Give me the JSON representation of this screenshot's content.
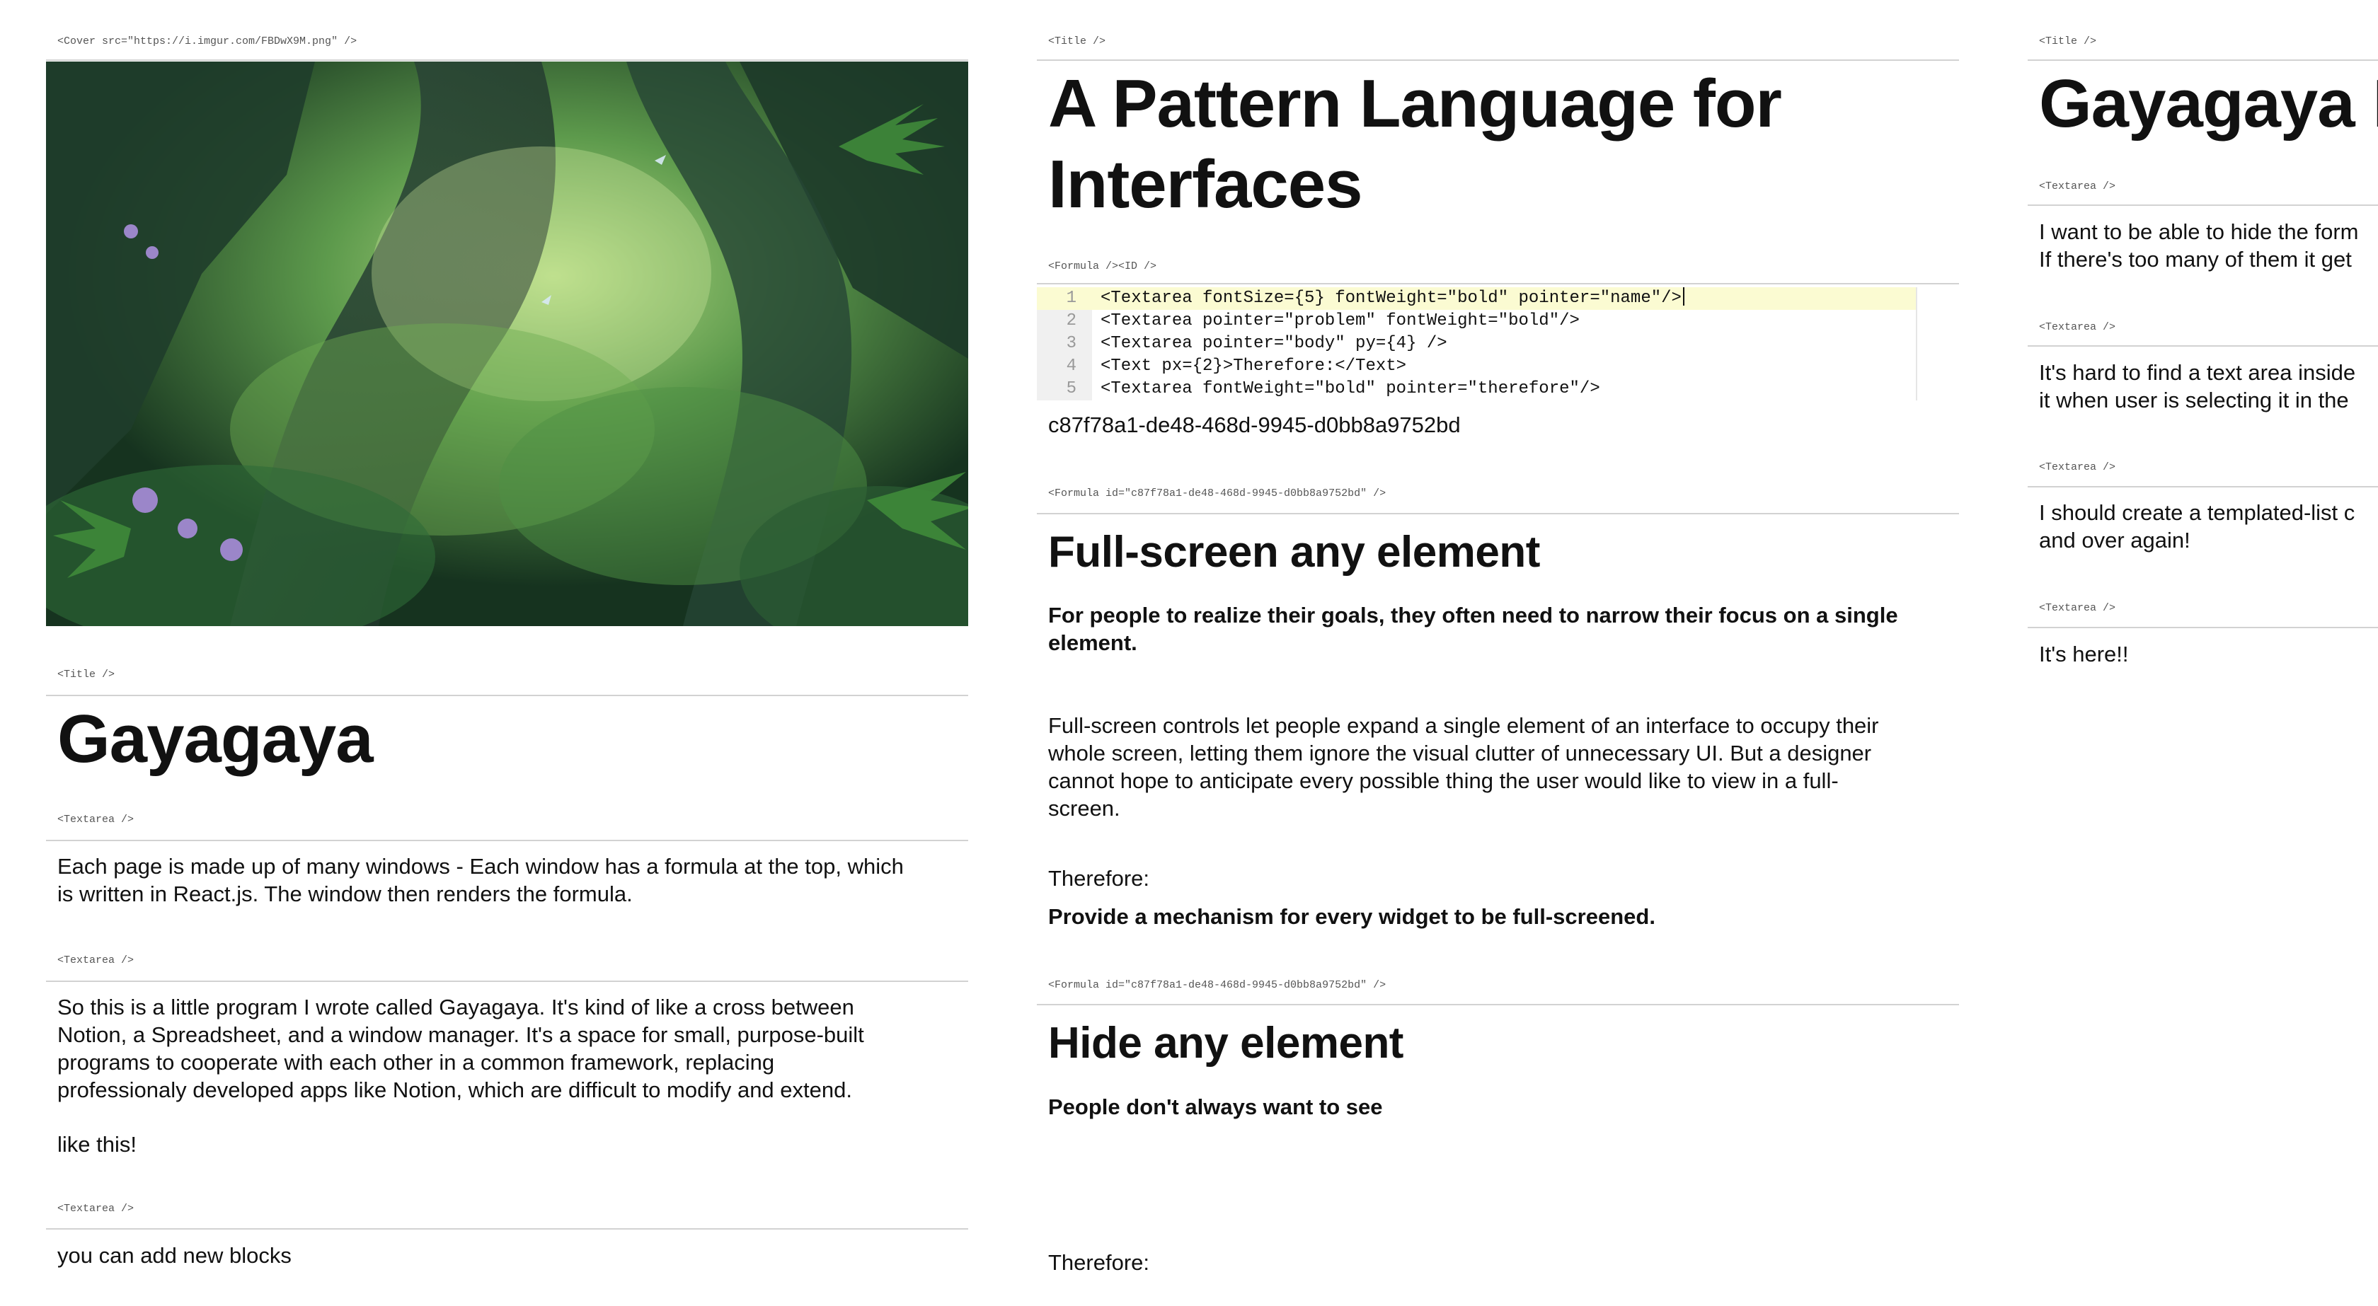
{
  "column1": {
    "cover": {
      "formula_label": "<Cover src=\"https://i.imgur.com/FBDwX9M.png\" />",
      "image_alt": "forest-illustration"
    },
    "title_block": {
      "formula_label": "<Title />",
      "title": "Gayagaya"
    },
    "textarea1": {
      "formula_label": "<Textarea />",
      "lines": [
        "Each page is made up of many windows - Each window has a formula at the top, which",
        "is written in React.js. The window then renders the formula."
      ]
    },
    "textarea2": {
      "formula_label": "<Textarea />",
      "lines": [
        "So this is a little program I wrote called Gayagaya. It's kind of like a cross between",
        "Notion, a Spreadsheet, and a window manager. It's a space for small, purpose-built",
        "programs to cooperate with each other in a common framework, replacing",
        "professionaly developed apps like Notion, which are difficult to modify and extend."
      ],
      "extra": "like this!"
    },
    "textarea3": {
      "formula_label": "<Textarea />",
      "text": "you can add new blocks"
    }
  },
  "column2": {
    "title_block": {
      "formula_label": "<Title />",
      "title_lines": [
        "A Pattern Language for",
        "Interfaces"
      ]
    },
    "formula_editor": {
      "formula_label": "<Formula /><ID />",
      "lines": [
        {
          "num": "1",
          "code": "<Textarea fontSize={5} fontWeight=\"bold\" pointer=\"name\"/>"
        },
        {
          "num": "2",
          "code": "<Textarea pointer=\"problem\" fontWeight=\"bold\"/>"
        },
        {
          "num": "3",
          "code": "<Textarea pointer=\"body\" py={4} />"
        },
        {
          "num": "4",
          "code": "<Text px={2}>Therefore:</Text>"
        },
        {
          "num": "5",
          "code": "<Textarea fontWeight=\"bold\" pointer=\"therefore\"/>"
        }
      ],
      "id_value": "c87f78a1-de48-468d-9945-d0bb8a9752bd"
    },
    "pattern1": {
      "formula_label": "<Formula id=\"c87f78a1-de48-468d-9945-d0bb8a9752bd\" />",
      "name": "Full-screen any element",
      "problem_lines": [
        "For people to realize their goals, they often need to narrow their focus on a single",
        "element."
      ],
      "body_lines": [
        "Full-screen controls let people expand a single element of an interface to occupy their",
        "whole screen, letting them ignore the visual clutter of unnecessary UI. But a designer",
        "cannot hope to anticipate every possible thing the user would like to view in a full-",
        "screen."
      ],
      "therefore_label": "Therefore:",
      "therefore": "Provide a mechanism for every widget to be full-screened."
    },
    "pattern2": {
      "formula_label": "<Formula id=\"c87f78a1-de48-468d-9945-d0bb8a9752bd\" />",
      "name": "Hide any element",
      "problem": "People don't always want to see",
      "therefore_label": "Therefore:"
    }
  },
  "column3": {
    "title_block": {
      "formula_label": "<Title />",
      "title": "Gayagaya I"
    },
    "textarea1": {
      "formula_label": "<Textarea />",
      "lines": [
        "I want to be able to hide the form",
        "If there's too many of them it get"
      ]
    },
    "textarea2": {
      "formula_label": "<Textarea />",
      "lines": [
        "It's hard to find a text area inside",
        "it when user is selecting it in the"
      ]
    },
    "textarea3": {
      "formula_label": "<Textarea />",
      "lines": [
        "I should create a templated-list c",
        "and over again!"
      ]
    },
    "textarea4": {
      "formula_label": "<Textarea />",
      "text": "It's here!!"
    }
  }
}
